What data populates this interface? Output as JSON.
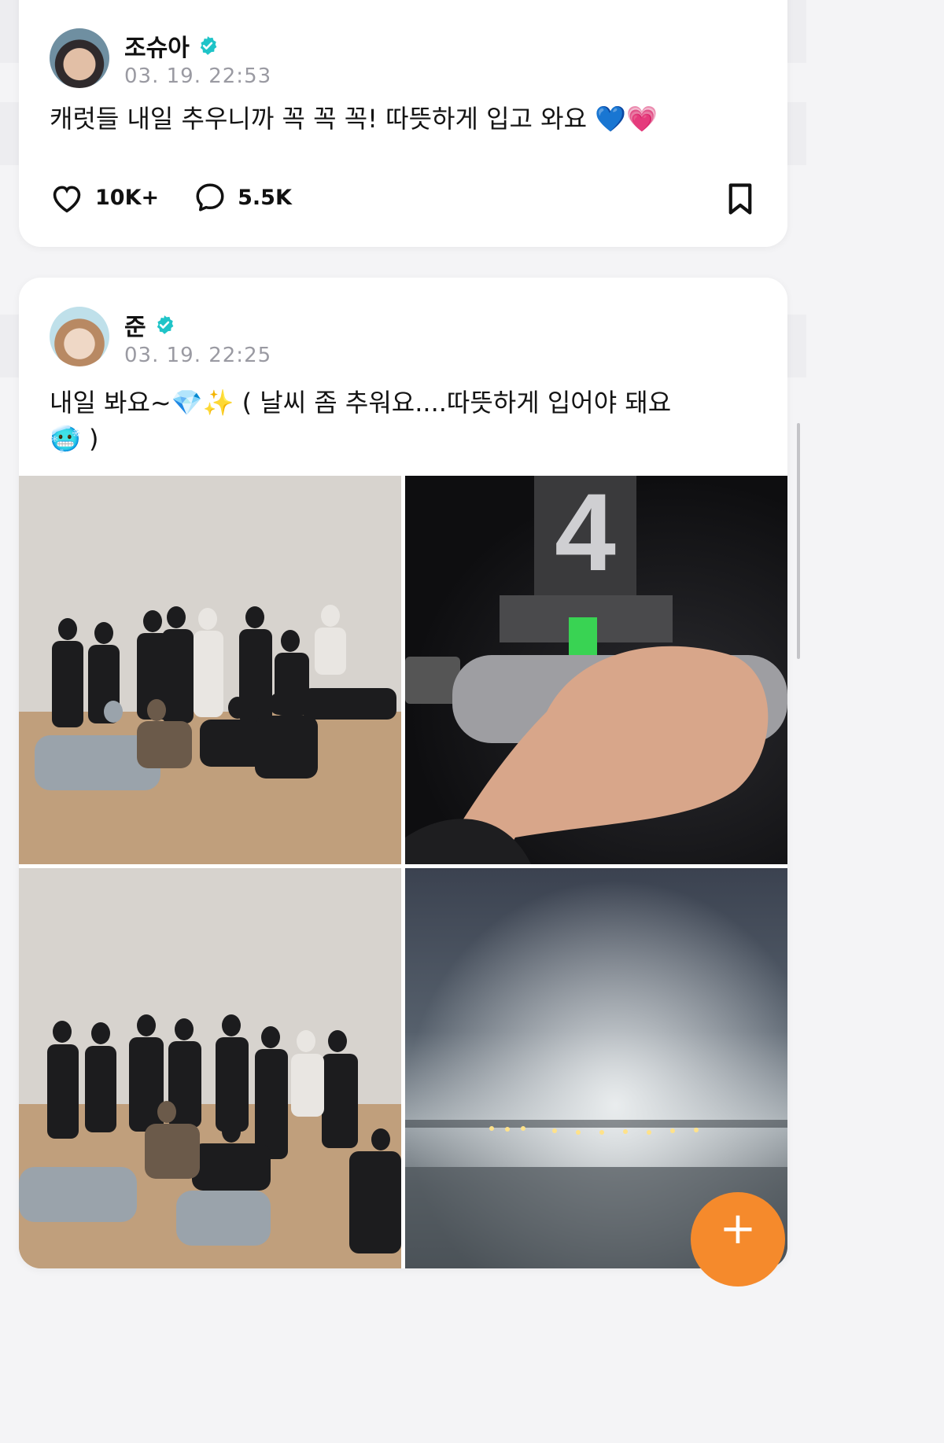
{
  "posts": [
    {
      "author": "조슈아",
      "timestamp": "03. 19. 22:53",
      "text": "캐럿들 내일 추우니까 꼭 꼭 꼭! 따뜻하게 입고 와요 💙💗",
      "likes": "10K+",
      "comments": "5.5K"
    },
    {
      "author": "준",
      "timestamp": "03. 19. 22:25",
      "text_line1": "내일 봐요~💎✨ ( 날씨 좀 추워요....따뜻하게 입어야 돼요",
      "text_line2": "🥶 )"
    }
  ],
  "colors": {
    "verified": "#1fc4c8",
    "fab": "#f58a2c"
  },
  "icons": {
    "like": "heart-icon",
    "comment": "comment-bubble-icon",
    "bookmark": "bookmark-icon",
    "verified": "verified-badge-icon",
    "fab": "plus-icon"
  },
  "fab_label": "+"
}
